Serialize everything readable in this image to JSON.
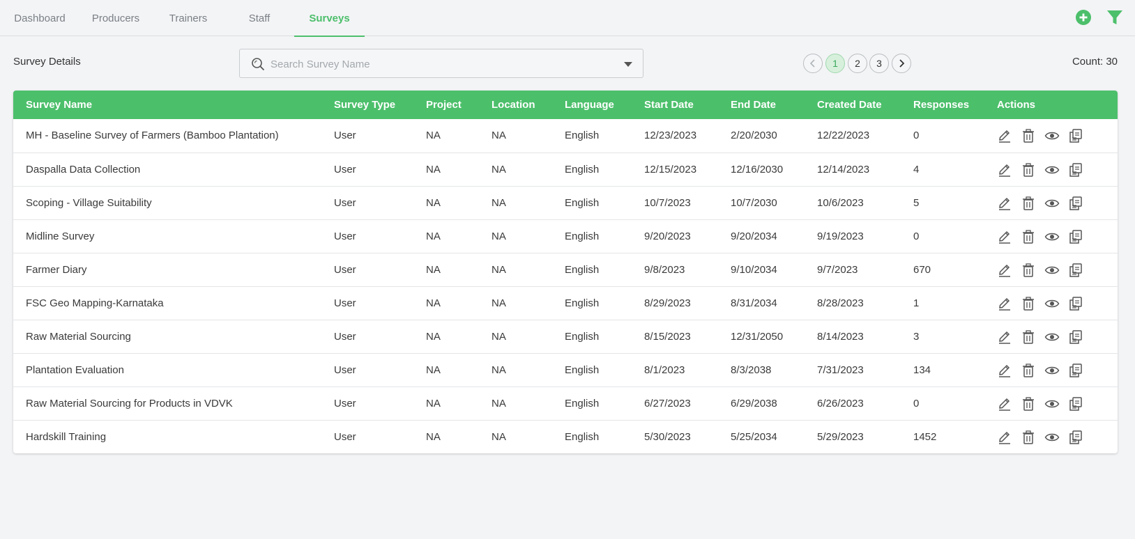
{
  "nav": {
    "tabs": [
      {
        "label": "Dashboard"
      },
      {
        "label": "Producers"
      },
      {
        "label": "Trainers"
      },
      {
        "label": "Staff"
      },
      {
        "label": "Surveys"
      }
    ],
    "active_tab": "Surveys",
    "icons": [
      "add-circle-icon",
      "filter-icon"
    ]
  },
  "toolbar": {
    "title": "Survey Details",
    "search_placeholder": "Search Survey Name",
    "pages": [
      "1",
      "2",
      "3"
    ],
    "current_page": "1",
    "count_label": "Count: 30"
  },
  "colors": {
    "accent": "#4cbf6b",
    "background": "#f3f4f6"
  },
  "table": {
    "headers": [
      "Survey Name",
      "Survey Type",
      "Project",
      "Location",
      "Language",
      "Start Date",
      "End Date",
      "Created Date",
      "Responses",
      "Actions"
    ],
    "action_icons": [
      "edit-icon",
      "delete-icon",
      "view-icon",
      "copy-icon"
    ],
    "rows": [
      [
        "MH - Baseline Survey of Farmers (Bamboo Plantation)",
        "User",
        "NA",
        "NA",
        "English",
        "12/23/2023",
        "2/20/2030",
        "12/22/2023",
        "0"
      ],
      [
        "Daspalla Data Collection",
        "User",
        "NA",
        "NA",
        "English",
        "12/15/2023",
        "12/16/2030",
        "12/14/2023",
        "4"
      ],
      [
        "Scoping - Village Suitability",
        "User",
        "NA",
        "NA",
        "English",
        "10/7/2023",
        "10/7/2030",
        "10/6/2023",
        "5"
      ],
      [
        "Midline Survey",
        "User",
        "NA",
        "NA",
        "English",
        "9/20/2023",
        "9/20/2034",
        "9/19/2023",
        "0"
      ],
      [
        "Farmer Diary",
        "User",
        "NA",
        "NA",
        "English",
        "9/8/2023",
        "9/10/2034",
        "9/7/2023",
        "670"
      ],
      [
        "FSC Geo Mapping-Karnataka",
        "User",
        "NA",
        "NA",
        "English",
        "8/29/2023",
        "8/31/2034",
        "8/28/2023",
        "1"
      ],
      [
        "Raw Material Sourcing",
        "User",
        "NA",
        "NA",
        "English",
        "8/15/2023",
        "12/31/2050",
        "8/14/2023",
        "3"
      ],
      [
        "Plantation Evaluation",
        "User",
        "NA",
        "NA",
        "English",
        "8/1/2023",
        "8/3/2038",
        "7/31/2023",
        "134"
      ],
      [
        "Raw Material Sourcing for Products in VDVK",
        "User",
        "NA",
        "NA",
        "English",
        "6/27/2023",
        "6/29/2038",
        "6/26/2023",
        "0"
      ],
      [
        "Hardskill Training",
        "User",
        "NA",
        "NA",
        "English",
        "5/30/2023",
        "5/25/2034",
        "5/29/2023",
        "1452"
      ]
    ]
  }
}
